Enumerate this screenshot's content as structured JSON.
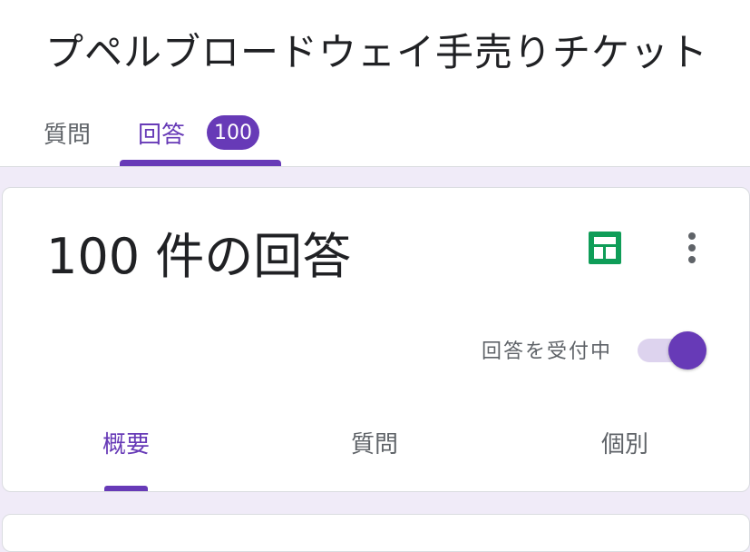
{
  "form": {
    "title": "プペルブロードウェイ手売りチケット"
  },
  "top_tabs": {
    "questions_label": "質問",
    "responses_label": "回答",
    "responses_count": "100",
    "active": "responses"
  },
  "responses_card": {
    "heading": "100 件の回答",
    "accepting_label": "回答を受付中",
    "accepting_enabled": true
  },
  "sub_tabs": {
    "summary_label": "概要",
    "question_label": "質問",
    "individual_label": "個別",
    "active": "summary"
  },
  "icons": {
    "sheets": "google-sheets-icon",
    "more": "more-vert-icon"
  },
  "colors": {
    "accent": "#673ab7",
    "sheets_green": "#0f9d58",
    "background": "#f0ebf8",
    "toggle_track": "#ddd3ee"
  }
}
